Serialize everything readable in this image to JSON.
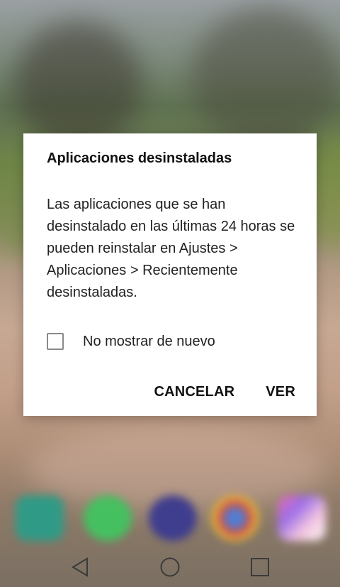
{
  "dialog": {
    "title": "Aplicaciones desinstaladas",
    "message": "Las aplicaciones que se han desinstalado en las últimas 24 horas se pueden reinstalar en Ajustes > Aplicaciones > Recientemente desinstaladas.",
    "checkbox_label": "No mostrar de nuevo",
    "checkbox_checked": false,
    "cancel_label": "CANCELAR",
    "confirm_label": "VER"
  },
  "dock": {
    "icons": [
      "phone-icon",
      "whatsapp-icon",
      "messaging-icon",
      "chrome-icon",
      "gallery-icon"
    ]
  },
  "nav": {
    "icons": [
      "back-icon",
      "home-icon",
      "recent-apps-icon"
    ]
  }
}
